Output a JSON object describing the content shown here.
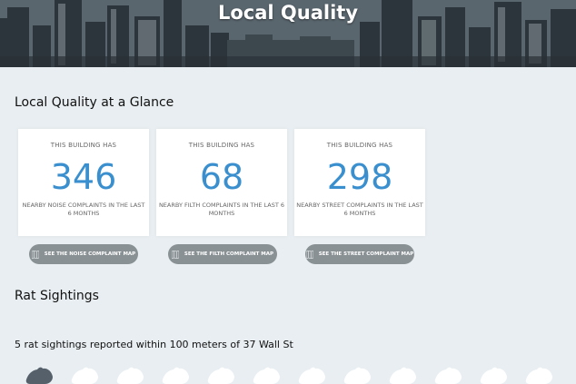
{
  "header": {
    "title": "Local Quality"
  },
  "glance": {
    "title": "Local Quality at a Glance",
    "cards": [
      {
        "top": "THIS BUILDING HAS",
        "value": "346",
        "bottom": "NEARBY NOISE COMPLAINTS IN THE LAST 6 MONTHS",
        "button": "SEE THE NOISE COMPLAINT MAP"
      },
      {
        "top": "THIS BUILDING HAS",
        "value": "68",
        "bottom": "NEARBY FILTH COMPLAINTS IN THE LAST 6 MONTHS",
        "button": "SEE THE FILTH COMPLAINT MAP"
      },
      {
        "top": "THIS BUILDING HAS",
        "value": "298",
        "bottom": "NEARBY STREET COMPLAINTS IN THE LAST 6 MONTHS",
        "button": "SEE THE STREET COMPLAINT MAP"
      }
    ]
  },
  "rats": {
    "title": "Rat Sightings",
    "summary": "5 rat sightings reported within 100 meters of 37 Wall St",
    "highlighted_count": 1,
    "total_icons": 12,
    "colors": {
      "highlighted": "#55606a",
      "faded": "#ffffff"
    }
  },
  "colors": {
    "accent": "#3a8fce",
    "button": "#8a9195",
    "background": "#e8eef1"
  }
}
